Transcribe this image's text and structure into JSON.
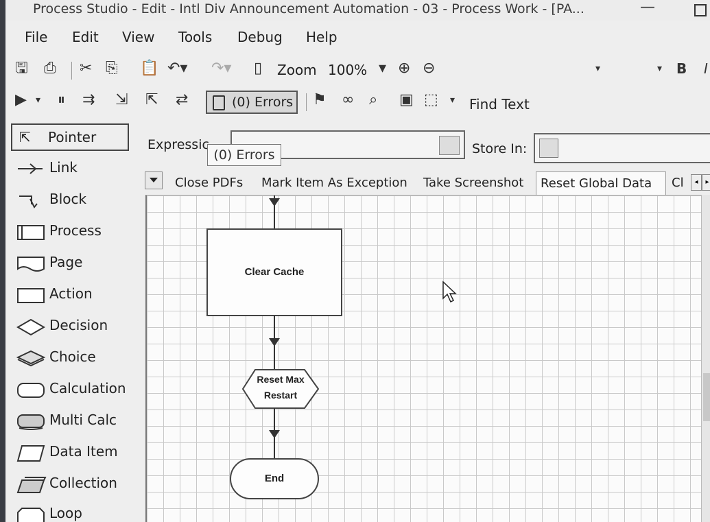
{
  "window": {
    "title": "Process Studio - Edit - Intl Div Announcement Automation - 03 - Process Work - [PA..."
  },
  "menu": [
    "File",
    "Edit",
    "View",
    "Tools",
    "Debug",
    "Help"
  ],
  "toolbar": {
    "zoom_label": "Zoom",
    "zoom_value": "100%",
    "errors_label": "(0) Errors",
    "find_text_label": "Find Text",
    "font_bold": "B",
    "font_italic": "I",
    "icons": [
      "save-icon",
      "print-icon",
      "cut-icon",
      "copy-icon",
      "paste-icon",
      "undo-icon",
      "redo-icon",
      "page-icon",
      "zoom-in-icon",
      "zoom-out-icon",
      "run-icon",
      "pause-icon",
      "step-icon",
      "step-in-icon",
      "step-out-icon",
      "refresh-icon",
      "breakpoint-icon",
      "link-icon",
      "find-icon",
      "window-icon",
      "select-icon"
    ]
  },
  "palette": [
    {
      "label": "Pointer",
      "icon": "pointer-icon"
    },
    {
      "label": "Link",
      "icon": "link-icon"
    },
    {
      "label": "Block",
      "icon": "block-icon"
    },
    {
      "label": "Process",
      "icon": "process-icon"
    },
    {
      "label": "Page",
      "icon": "page-icon"
    },
    {
      "label": "Action",
      "icon": "action-icon"
    },
    {
      "label": "Decision",
      "icon": "decision-icon"
    },
    {
      "label": "Choice",
      "icon": "choice-icon"
    },
    {
      "label": "Calculation",
      "icon": "calculation-icon"
    },
    {
      "label": "Multi Calc",
      "icon": "multi-calc-icon"
    },
    {
      "label": "Data Item",
      "icon": "data-item-icon"
    },
    {
      "label": "Collection",
      "icon": "collection-icon"
    },
    {
      "label": "Loop",
      "icon": "loop-icon"
    }
  ],
  "expression": {
    "label": "Expressic",
    "value": "",
    "store_in_label": "Store In:",
    "store_in_value": ""
  },
  "tooltip": "(0) Errors",
  "tabs": {
    "items": [
      "Close PDFs",
      "Mark Item As Exception",
      "Take Screenshot",
      "Reset Global Data",
      "Cl"
    ],
    "active_index": 3
  },
  "flow": {
    "action_label": "Clear Cache",
    "calc_label_line1": "Reset Max",
    "calc_label_line2": "Restart",
    "end_label": "End"
  }
}
